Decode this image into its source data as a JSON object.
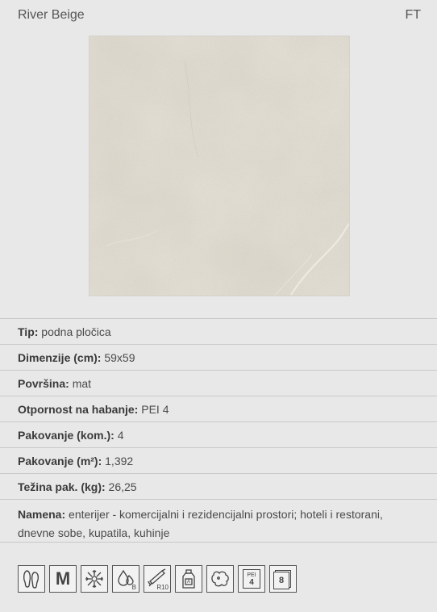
{
  "product": {
    "name": "River Beige",
    "code": "FT"
  },
  "specs": [
    {
      "label": "Tip:",
      "value": "podna pločica"
    },
    {
      "label": "Dimenzije (cm):",
      "value": "59x59"
    },
    {
      "label": "Površina:",
      "value": "mat"
    },
    {
      "label": "Otpornost na habanje:",
      "value": "PEI 4"
    },
    {
      "label": "Pakovanje (kom.):",
      "value": "4"
    },
    {
      "label": "Pakovanje (m²):",
      "value": "1,392"
    },
    {
      "label": "Težina pak. (kg):",
      "value": "26,25"
    },
    {
      "label": "Namena:",
      "value": "enterijer - komercijalni i rezidencijalni prostori; hoteli i restorani, dnevne sobe, kupatila, kuhinje"
    }
  ],
  "feature_icons": [
    {
      "icon": "footprints-icon",
      "text": ""
    },
    {
      "icon": "m-letter-icon",
      "text": "M"
    },
    {
      "icon": "frost-resistant-icon",
      "text": ""
    },
    {
      "icon": "water-absorption-b-icon",
      "text": "B"
    },
    {
      "icon": "slip-resistance-r10-icon",
      "text": "R10"
    },
    {
      "icon": "chemical-resistance-icon",
      "text": "A"
    },
    {
      "icon": "stain-resistance-icon",
      "text": ""
    },
    {
      "icon": "pei-rating-icon",
      "text": "PEI",
      "value": "4"
    },
    {
      "icon": "tiles-per-box-icon",
      "text": "8"
    }
  ],
  "colors": {
    "background": "#e8e8e8",
    "tile": "#ddd8cc",
    "divider": "#c9c9c9"
  }
}
